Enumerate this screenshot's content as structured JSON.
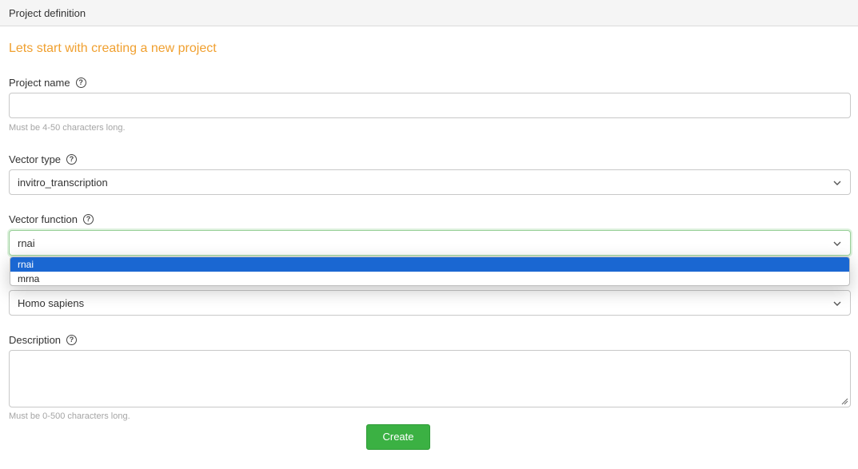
{
  "header": {
    "title": "Project definition"
  },
  "intro": "Lets start with creating a new project",
  "project_name": {
    "label": "Project name",
    "value": "",
    "hint": "Must be 4-50 characters long."
  },
  "vector_type": {
    "label": "Vector type",
    "value": "invitro_transcription"
  },
  "vector_function": {
    "label": "Vector function",
    "value": "rnai",
    "options": [
      "rnai",
      "mrna"
    ],
    "highlighted_option": "rnai"
  },
  "species": {
    "value": "Homo sapiens"
  },
  "description": {
    "label": "Description",
    "value": "",
    "hint": "Must be 0-500 characters long."
  },
  "create_button": {
    "label": "Create"
  },
  "icons": {
    "help": "help-circle-icon",
    "chevron": "chevron-down-icon",
    "resize": "resize-handle-icon"
  },
  "colors": {
    "intro_text": "#f0a030",
    "create_button": "#3bb143",
    "option_highlight": "#1a67d2",
    "focus_border": "#9ad09a",
    "hint_text": "#a5a5a5"
  }
}
